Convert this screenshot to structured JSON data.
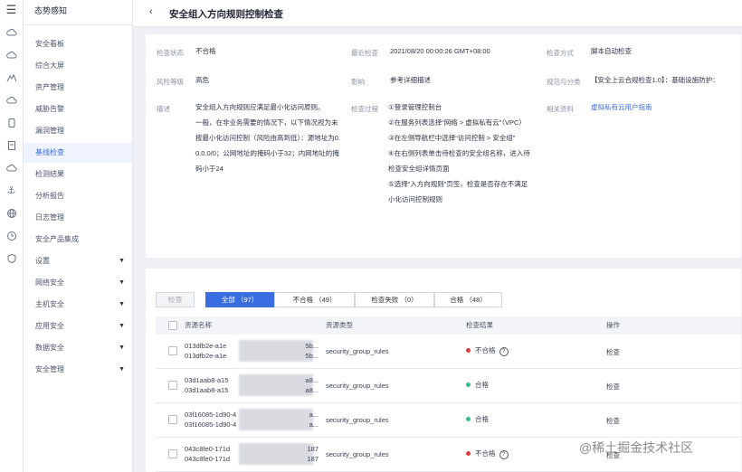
{
  "rail": {
    "icons": [
      "menu-icon",
      "cloud-icon",
      "cloud-icon",
      "shield-icon",
      "cloud-icon",
      "database-icon",
      "server-icon",
      "cloud-icon",
      "anchor-icon",
      "globe-icon",
      "clock-icon",
      "shield-icon"
    ]
  },
  "menu_glyph": "☰",
  "sidebar": {
    "title": "态势感知",
    "items": [
      {
        "label": "安全看板"
      },
      {
        "label": "综合大屏"
      },
      {
        "label": "资产管理"
      },
      {
        "label": "威胁告警"
      },
      {
        "label": "漏洞管理"
      },
      {
        "label": "基线检查"
      },
      {
        "label": "检测结果"
      },
      {
        "label": "分析报告"
      },
      {
        "label": "日志管理"
      },
      {
        "label": "安全产品集成"
      },
      {
        "label": "设置",
        "expandable": true
      },
      {
        "label": "网络安全",
        "expandable": true
      },
      {
        "label": "主机安全",
        "expandable": true
      },
      {
        "label": "应用安全",
        "expandable": true
      },
      {
        "label": "数据安全",
        "expandable": true
      },
      {
        "label": "安全管理",
        "expandable": true
      }
    ],
    "active_index": 5
  },
  "header": {
    "back_icon": "‹",
    "title": "安全组入方向规则控制检查"
  },
  "info": {
    "status_label": "检查状态",
    "status_value": "不合格",
    "latest_label": "最近检查",
    "latest_value": "2021/08/20 00:00:26 GMT+08:00",
    "method_label": "检查方式",
    "method_value": "脚本自动检查",
    "risk_label": "风险等级",
    "risk_value": "高危",
    "impact_label": "影响",
    "impact_value": "参考详细描述",
    "spec_label": "规范与分类",
    "spec_value": "【安全上云合规检查1.0】：基础设施防护：",
    "desc_label": "描述",
    "desc_lines": [
      "安全组入方向规则应满足最小化访问原则。",
      "一般，在非业务需要的情况下，以下情况视为未",
      "按最小化访问控制（风险由高到低）：源地址为0.",
      "0.0.0/0；公网地址的掩码小于32；内网地址的掩",
      "码小于24"
    ],
    "process_label": "检查过程",
    "process_lines": [
      "①登录管理控制台",
      "②在服务列表选择“网络 > 虚拟私有云”（VPC）",
      "③在左侧导航栏中选择“访问控制 > 安全组”",
      "④在右侧列表单击待检查的安全组名称，进入待",
      "检查安全组详情页面",
      "⑤选择“入方向规则”页签，检查是否存在不满足",
      "小化访问控制规则"
    ],
    "ref_label": "相关资料",
    "ref_value": "虚拟私有云用户指南"
  },
  "toolbar": {
    "check_button": "检查"
  },
  "tabs": [
    {
      "label": "全部 （97）"
    },
    {
      "label": "不合格 （49）"
    },
    {
      "label": "检查失败 （0）"
    },
    {
      "label": "合格 （48）"
    }
  ],
  "table": {
    "headers": [
      "资源名称",
      "资源类型",
      "检查结果",
      "操作"
    ],
    "rows": [
      {
        "id1": "013dfb2e-a1e",
        "id2": "013dfb2e-a1e",
        "tail1": "5b...",
        "tail2": "5b...",
        "type": "security_group_rules",
        "result": "不合格",
        "result_color": "#e0393e",
        "has_help": true,
        "action": "检查"
      },
      {
        "id1": "03d1aab8-a15",
        "id2": "03d1aab8-a15",
        "tail1": "a8...",
        "tail2": "a8...",
        "type": "security_group_rules",
        "result": "合格",
        "result_color": "#2fbf8c",
        "has_help": false,
        "action": "检查"
      },
      {
        "id1": "03f16085-1d90-4",
        "id2": "03f16085-1d90-4",
        "tail1": "a...",
        "tail2": "a...",
        "type": "security_group_rules",
        "result": "合格",
        "result_color": "#2fbf8c",
        "has_help": false,
        "action": "检查"
      },
      {
        "id1": "043c8fe0-171d",
        "id2": "043c8fe0-171d",
        "tail1": "187",
        "tail2": "187",
        "type": "security_group_rules",
        "result": "不合格",
        "result_color": "#e0393e",
        "has_help": true,
        "action": "检查"
      }
    ],
    "help_glyph": "?"
  },
  "watermark": "@稀土掘金技术社区"
}
